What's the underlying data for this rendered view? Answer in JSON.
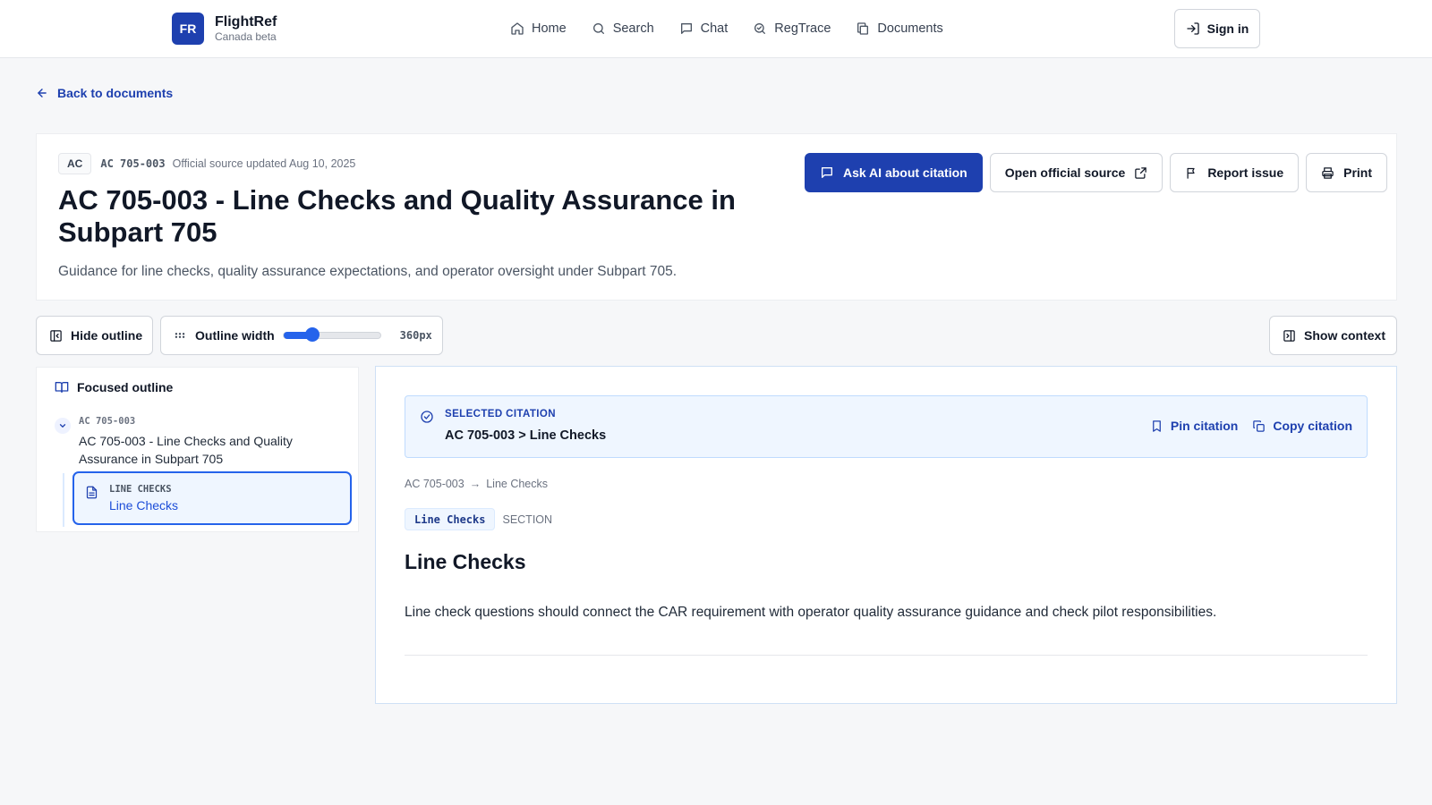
{
  "brand": {
    "logo": "FR",
    "name": "FlightRef",
    "tagline": "Canada beta"
  },
  "nav": {
    "items": [
      {
        "label": "Home",
        "icon": "home-icon"
      },
      {
        "label": "Search",
        "icon": "search-icon"
      },
      {
        "label": "Chat",
        "icon": "chat-icon"
      },
      {
        "label": "RegTrace",
        "icon": "regtrace-icon"
      },
      {
        "label": "Documents",
        "icon": "documents-icon"
      }
    ],
    "signin_label": "Sign in"
  },
  "back_link": "Back to documents",
  "document": {
    "type_badge": "AC",
    "id": "AC 705-003",
    "updated": "Official source updated Aug 10, 2025",
    "title": "AC 705-003 - Line Checks and Quality Assurance in Subpart 705",
    "description": "Guidance for line checks, quality assurance expectations, and operator oversight under Subpart 705."
  },
  "actions": {
    "ask_ai": "Ask AI about citation",
    "open_source": "Open official source",
    "report": "Report issue",
    "print": "Print"
  },
  "toolbar": {
    "hide_outline": "Hide outline",
    "outline_width_label": "Outline width",
    "outline_width_value": "360px",
    "outline_width_fraction": 0.3,
    "show_context": "Show context"
  },
  "outline": {
    "heading": "Focused outline",
    "parent": {
      "id": "AC 705-003",
      "title": "AC 705-003 - Line Checks and Quality Assurance in Subpart 705"
    },
    "child": {
      "id": "LINE CHECKS",
      "title": "Line Checks"
    }
  },
  "citation": {
    "label": "SELECTED CITATION",
    "value": "AC 705-003 > Line Checks",
    "pin": "Pin citation",
    "copy": "Copy citation"
  },
  "breadcrumb": {
    "items": [
      "AC 705-003",
      "Line Checks"
    ],
    "separator": "→"
  },
  "section": {
    "tag": "Line Checks",
    "type": "SECTION",
    "title": "Line Checks",
    "body": "Line check questions should connect the CAR requirement with operator quality assurance guidance and check pilot responsibilities."
  },
  "colors": {
    "accent": "#1e40af",
    "accent_light": "#eff6ff",
    "slider": "#2563eb"
  }
}
